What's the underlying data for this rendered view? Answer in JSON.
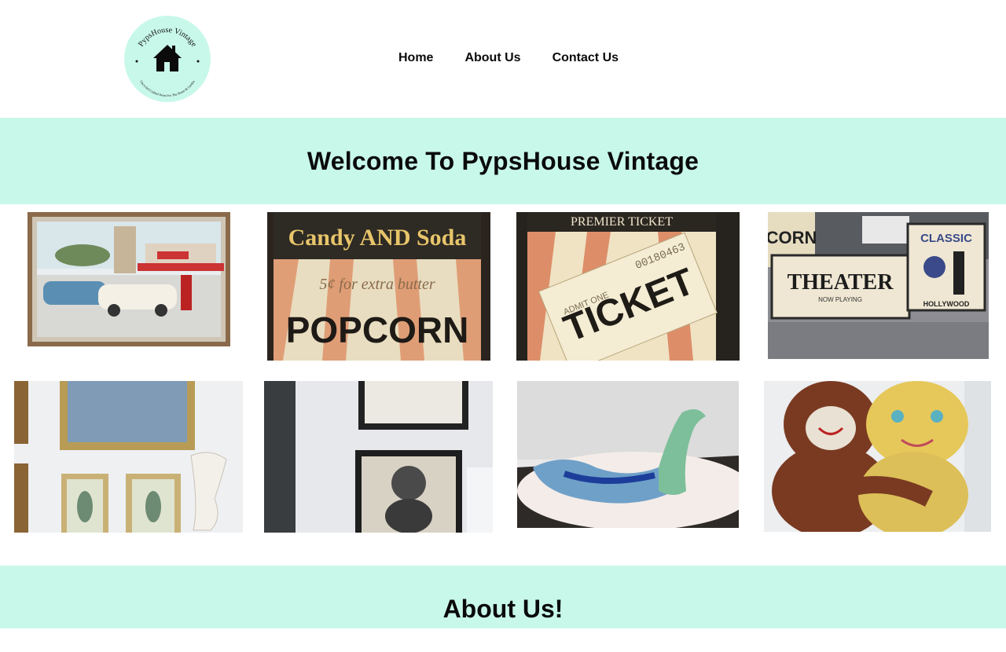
{
  "brand": {
    "name": "PypsHouse Vintage",
    "tagline": "Upcycled Crafted Items For The Home & Garden",
    "accent_color": "#c8f8ea"
  },
  "nav": {
    "items": [
      {
        "label": "Home"
      },
      {
        "label": "About Us"
      },
      {
        "label": "Contact Us"
      }
    ]
  },
  "hero": {
    "title": "Welcome To PypsHouse Vintage"
  },
  "gallery": {
    "items": [
      {
        "name": "retro-diner-painting",
        "caption": ""
      },
      {
        "name": "candy-and-soda-popcorn-sign",
        "sign_top": "Candy AND Soda",
        "sign_mid": "5¢ for extra butter",
        "sign_main": "POPCORN"
      },
      {
        "name": "admit-one-ticket-sign",
        "sign_top": "PREMIER TICKET",
        "serial": "00180463",
        "sign_main": "TICKET",
        "admit": "ADMIT ONE"
      },
      {
        "name": "theater-signs",
        "sign_a": "CORN",
        "sign_b": "THEATER",
        "sign_b_sub": "NOW PLAYING",
        "sign_c": "CLASSIC",
        "sign_c_sub": "HOLLYWOOD"
      },
      {
        "name": "framed-pictures-wall"
      },
      {
        "name": "poodle-prints"
      },
      {
        "name": "glass-swan-dish"
      },
      {
        "name": "hugging-teddy-bears"
      }
    ]
  },
  "about": {
    "title": "About Us!"
  }
}
